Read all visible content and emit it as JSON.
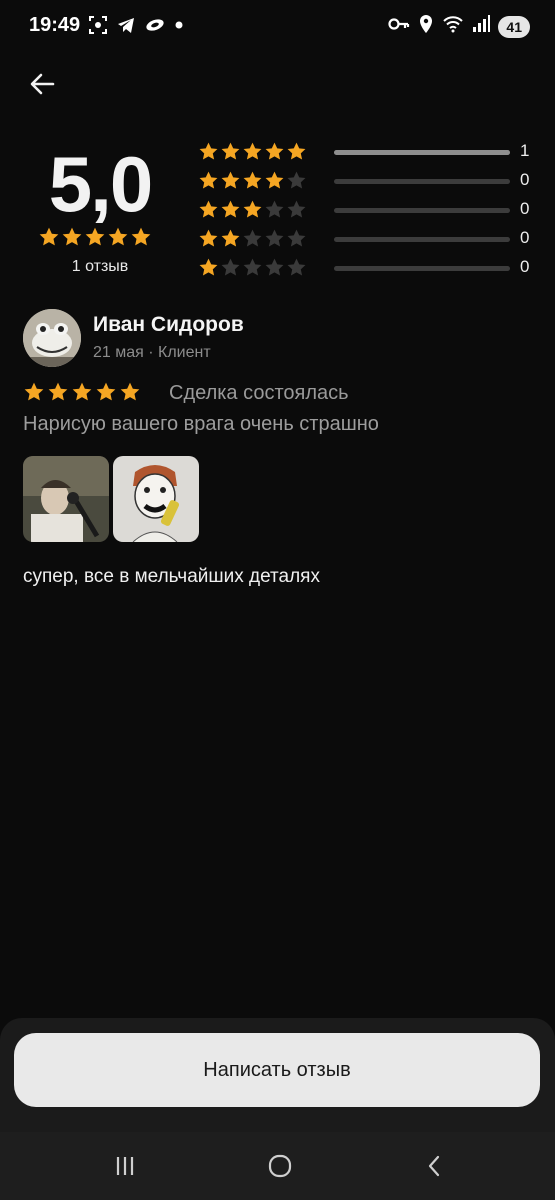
{
  "status_bar": {
    "time": "19:49",
    "battery": "41",
    "left_icons": [
      "screenshot-icon",
      "telegram-icon",
      "app-icon",
      "dot-icon"
    ],
    "right_icons": [
      "key-icon",
      "location-icon",
      "wifi-icon",
      "signal-icon"
    ]
  },
  "summary": {
    "rating": "5,0",
    "stars": 5,
    "review_count_label": "1 отзыв",
    "distribution": [
      {
        "stars": 5,
        "count": "1",
        "fraction": 1.0
      },
      {
        "stars": 4,
        "count": "0",
        "fraction": 0
      },
      {
        "stars": 3,
        "count": "0",
        "fraction": 0
      },
      {
        "stars": 2,
        "count": "0",
        "fraction": 0
      },
      {
        "stars": 1,
        "count": "0",
        "fraction": 0
      }
    ]
  },
  "review": {
    "author": "Иван Сидоров",
    "meta": "21 мая · Клиент",
    "stars": 5,
    "deal_status": "Сделка состоялась",
    "subject": "Нарисую вашего врага очень страшно",
    "photos": [
      "photo-man",
      "photo-drawing"
    ],
    "text": "супер, все в мельчайших деталях"
  },
  "actions": {
    "write_review": "Написать отзыв"
  },
  "colors": {
    "background": "#0b0b0b",
    "star_filled": "#f5a623",
    "star_empty": "#3a3a3a",
    "button_bg": "#e9e9e9"
  }
}
